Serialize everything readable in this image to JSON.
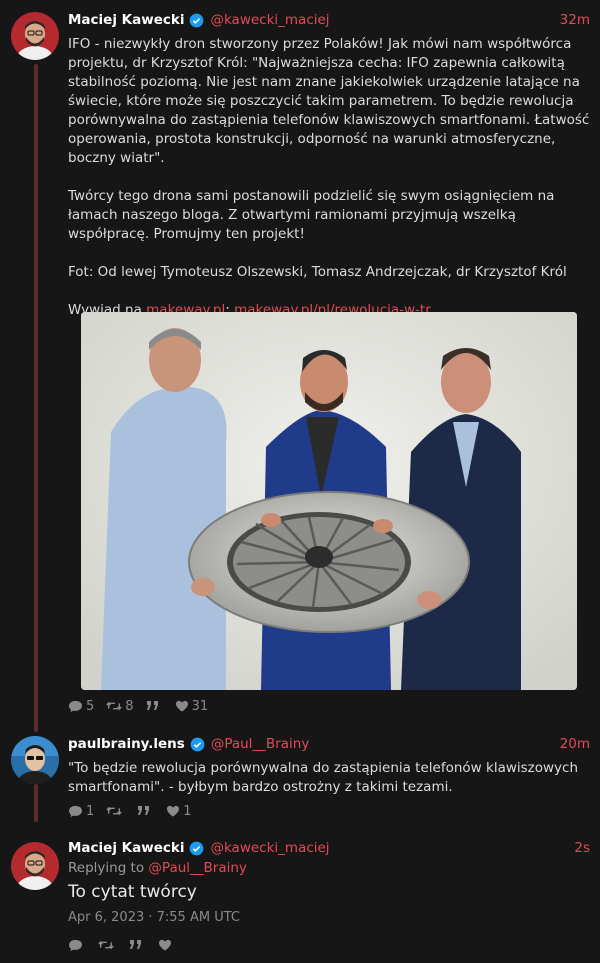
{
  "tweets": [
    {
      "author": "Maciej Kawecki",
      "handle": "@kawecki_maciej",
      "time": "32m",
      "text": "IFO - niezwykły dron stworzony przez Polaków! Jak mówi nam współtwórca projektu, dr Krzysztof Król: \"Najważniejsza cecha: IFO zapewnia całkowitą stabilność poziomą. Nie jest nam znane jakiekolwiek urządzenie latające na świecie, które może się poszczycić takim parametrem. To będzie rewolucja porównywalna do zastąpienia telefonów klawiszowych smartfonami. Łatwość operowania, prostota konstrukcji, odporność na warunki atmosferyczne, boczny wiatr\".\n\nTwórcy tego drona sami postanowili podzielić się swym osiągnięciem na łamach naszego bloga. Z otwartymi ramionami przyjmują wszelką współpracę. Promujmy ten projekt!\n\nFot: Od lewej Tymoteusz Olszewski, Tomasz Andrzejczak, dr Krzysztof Król",
      "interview_prefix": "Wywiad na ",
      "interview_link1": "makeway.pl",
      "interview_sep": ": ",
      "interview_link2": "makeway.pl/pl/rewolucja-w-tr…",
      "stats": {
        "replies": "5",
        "retweets": "8",
        "quotes": "",
        "likes": "31"
      },
      "icons": [
        "comment-icon",
        "retweet-icon",
        "quote-icon",
        "heart-icon"
      ]
    },
    {
      "author": "paulbrainy.lens",
      "handle": "@Paul__Brainy",
      "time": "20m",
      "text": "\"To będzie rewolucja porównywalna do zastąpienia telefonów klawiszowych smartfonami\". - byłbym bardzo ostrożny z takimi tezami.",
      "stats": {
        "replies": "1",
        "retweets": "",
        "quotes": "",
        "likes": "1"
      }
    },
    {
      "author": "Maciej Kawecki",
      "handle": "@kawecki_maciej",
      "time": "2s",
      "replying_prefix": "Replying to ",
      "replying_to": "@Paul__Brainy",
      "text": "To cytat twórcy",
      "date": "Apr 6, 2023 · 7:55 AM UTC",
      "stats": {
        "replies": "",
        "retweets": "",
        "quotes": "",
        "likes": ""
      }
    }
  ],
  "colors": {
    "background": "#161616",
    "accent": "#e34a55",
    "verified": "#1d9bf0",
    "thread_line": "#5e2a2f"
  }
}
